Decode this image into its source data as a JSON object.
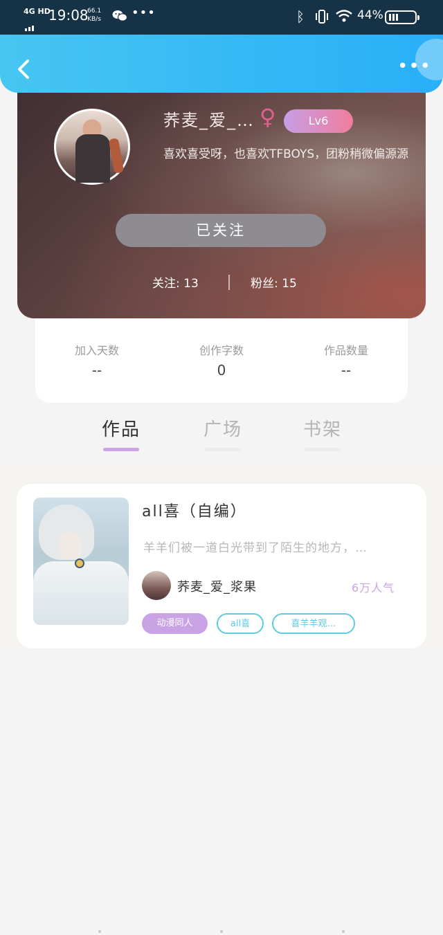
{
  "status_bar": {
    "network": "4G HD",
    "time": "19:08",
    "speed_value": "66.1",
    "speed_unit": "KB/s",
    "battery_text": "44%",
    "battery_level": 0.44,
    "icons": [
      "wechat-icon",
      "more-dots-icon",
      "bluetooth-icon",
      "vibrate-icon",
      "wifi-icon",
      "battery-icon"
    ]
  },
  "header": {
    "back_icon": "chevron-left-icon",
    "more_icon": "more-horizontal-icon",
    "accent": "#28aff8"
  },
  "profile": {
    "username": "荞麦_爱_…",
    "gender_symbol": "♀",
    "gender_color": "#e35f8e",
    "level": "Lv6",
    "bio": "喜欢喜受呀，也喜欢TFBOYS，团粉稍微偏源源",
    "follow_button": "已关注",
    "following_label": "关注:",
    "following_count": "13",
    "fans_label": "粉丝:",
    "fans_count": "15"
  },
  "stats": [
    {
      "label": "加入天数",
      "value": "--"
    },
    {
      "label": "创作字数",
      "value": "0"
    },
    {
      "label": "作品数量",
      "value": "--"
    }
  ],
  "tabs": [
    {
      "label": "作品",
      "active": true
    },
    {
      "label": "广场",
      "active": false
    },
    {
      "label": "书架",
      "active": false
    }
  ],
  "works": [
    {
      "title": "all喜（自编）",
      "description": "羊羊们被一道白光带到了陌生的地方，…",
      "author": "荞麦_爱_浆果",
      "popularity": "6万人气",
      "tags": [
        "动漫同人",
        "all喜",
        "喜羊羊观…"
      ]
    }
  ],
  "colors": {
    "tab_underline": "#c9a3e5",
    "tag_outline": "#5ccbe0"
  }
}
